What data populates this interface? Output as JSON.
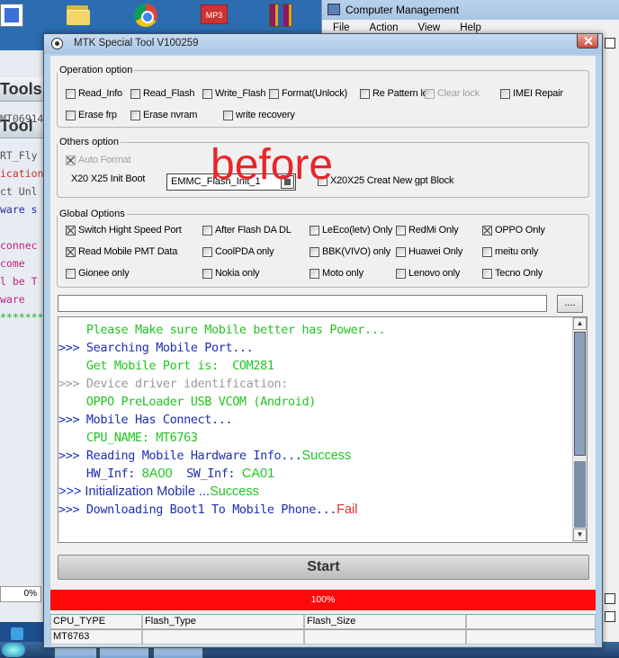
{
  "left_app": {
    "toolbar1": "Tools",
    "toolbar2": "Tool",
    "lines": [
      {
        "text": "MT06914",
        "color": "#555555"
      },
      {
        "text": "RT_Fly",
        "color": "#555555"
      },
      {
        "text": "ication",
        "color": "#d03030"
      },
      {
        "text": "ct Unl",
        "color": "#555555"
      },
      {
        "text": "ware s",
        "color": "#2a2aa0"
      },
      {
        "text": "connec",
        "color": "#c02080"
      },
      {
        "text": " come",
        "color": "#c02080"
      },
      {
        "text": "l be T",
        "color": "#c02080"
      },
      {
        "text": "ware",
        "color": "#c02080"
      },
      {
        "text": "********",
        "color": "#22aa22"
      }
    ],
    "percent": "0%"
  },
  "desktop": {
    "mp3_label": "MP3"
  },
  "computer_management": {
    "title": "Computer Management",
    "menu": [
      "File",
      "Action",
      "View",
      "Help"
    ]
  },
  "window": {
    "title": "MTK Special Tool V100259"
  },
  "operation_option": {
    "legend": "Operation option",
    "items": [
      {
        "label": "Read_Info",
        "checked": false,
        "disabled": false
      },
      {
        "label": "Read_Flash",
        "checked": false,
        "disabled": false
      },
      {
        "label": "Write_Flash",
        "checked": false,
        "disabled": false
      },
      {
        "label": "Format(Unlock)",
        "checked": false,
        "disabled": false
      },
      {
        "label": "Re Pattern lo",
        "checked": false,
        "disabled": false
      },
      {
        "label": "Clear lock",
        "checked": false,
        "disabled": true
      },
      {
        "label": "IMEI Repair",
        "checked": false,
        "disabled": false
      },
      {
        "label": "Erase frp",
        "checked": false,
        "disabled": false
      },
      {
        "label": "Erase nvram",
        "checked": false,
        "disabled": false
      },
      {
        "label": "write recovery",
        "checked": false,
        "disabled": false
      }
    ]
  },
  "others_option": {
    "legend": "Others option",
    "auto_format": "Auto Format",
    "init_boot_label": "X20 X25 Init Boot",
    "init_boot_value": "EMMC_Flash_Init_1",
    "gpt_label": "X20X25 Creat New gpt Block"
  },
  "global_options": {
    "legend": "Global Options",
    "items": [
      {
        "label": "Switch Hight Speed Port",
        "checked": true
      },
      {
        "label": "After Flash DA DL",
        "checked": false
      },
      {
        "label": "LeEco(letv) Only",
        "checked": false
      },
      {
        "label": "RedMi Only",
        "checked": false
      },
      {
        "label": "OPPO Only",
        "checked": true
      },
      {
        "label": "Read Mobile PMT Data",
        "checked": true
      },
      {
        "label": "CoolPDA only",
        "checked": false
      },
      {
        "label": "BBK(VIVO) only",
        "checked": false
      },
      {
        "label": "Huawei Only",
        "checked": false
      },
      {
        "label": "meitu only",
        "checked": false
      },
      {
        "label": "Gionee only",
        "checked": false
      },
      {
        "label": "Nokia only",
        "checked": false
      },
      {
        "label": "Moto only",
        "checked": false
      },
      {
        "label": "Lenovo only",
        "checked": false
      },
      {
        "label": "Tecno Only",
        "checked": false
      }
    ]
  },
  "overlay_text": "before",
  "path": {
    "value": "",
    "browse_label": "...."
  },
  "log": [
    {
      "parts": [
        {
          "text": "    Please Make sure Mobile better has Power...",
          "color": "green",
          "font": "mono"
        }
      ]
    },
    {
      "parts": [
        {
          "text": ">>> Searching Mobile Port...",
          "color": "blue",
          "font": "mono"
        }
      ]
    },
    {
      "parts": [
        {
          "text": "    Get Mobile Port is:  COM281",
          "color": "green",
          "font": "mono"
        }
      ]
    },
    {
      "parts": [
        {
          "text": ">>> Device driver identification:",
          "color": "gray",
          "font": "mono"
        }
      ]
    },
    {
      "parts": [
        {
          "text": "    OPPO PreLoader USB VCOM (Android)",
          "color": "green",
          "font": "mono"
        }
      ]
    },
    {
      "parts": [
        {
          "text": ">>> Mobile Has Connect...",
          "color": "blue",
          "font": "mono"
        }
      ]
    },
    {
      "parts": [
        {
          "text": "    CPU_NAME: MT6763",
          "color": "green",
          "font": "mono"
        }
      ]
    },
    {
      "parts": [
        {
          "text": ">>> Reading Mobile Hardware Info...",
          "color": "blue",
          "font": "mono"
        },
        {
          "text": "Success",
          "color": "green",
          "font": "sans"
        }
      ]
    },
    {
      "parts": [
        {
          "text": "    HW_Inf: ",
          "color": "blue",
          "font": "mono"
        },
        {
          "text": "8A00",
          "color": "green",
          "font": "sans"
        },
        {
          "text": "  SW_Inf: ",
          "color": "blue",
          "font": "mono"
        },
        {
          "text": "CA01",
          "color": "green",
          "font": "sans"
        }
      ]
    },
    {
      "parts": [
        {
          "text": ">>> Initialization Mobile ...",
          "color": "blue",
          "font": "sans"
        },
        {
          "text": "Success",
          "color": "green",
          "font": "sans"
        }
      ]
    },
    {
      "parts": [
        {
          "text": ">>> Downloading Boot1 To Mobile Phone...",
          "color": "blue",
          "font": "mono"
        },
        {
          "text": "Fail",
          "color": "red",
          "font": "sans"
        }
      ]
    }
  ],
  "start_label": "Start",
  "progress": {
    "label": "100%",
    "fraction": 1.0
  },
  "status": {
    "headers": [
      "CPU_TYPE",
      "Flash_Type",
      "Flash_Size",
      ""
    ],
    "values": [
      "MT6763",
      "",
      "",
      ""
    ]
  },
  "colors": {
    "progress_fill": "#ff0a0a",
    "log_green": "#22c422",
    "log_blue": "#1e2fb0",
    "log_red": "#e03030",
    "overlay": "#e8262a"
  }
}
